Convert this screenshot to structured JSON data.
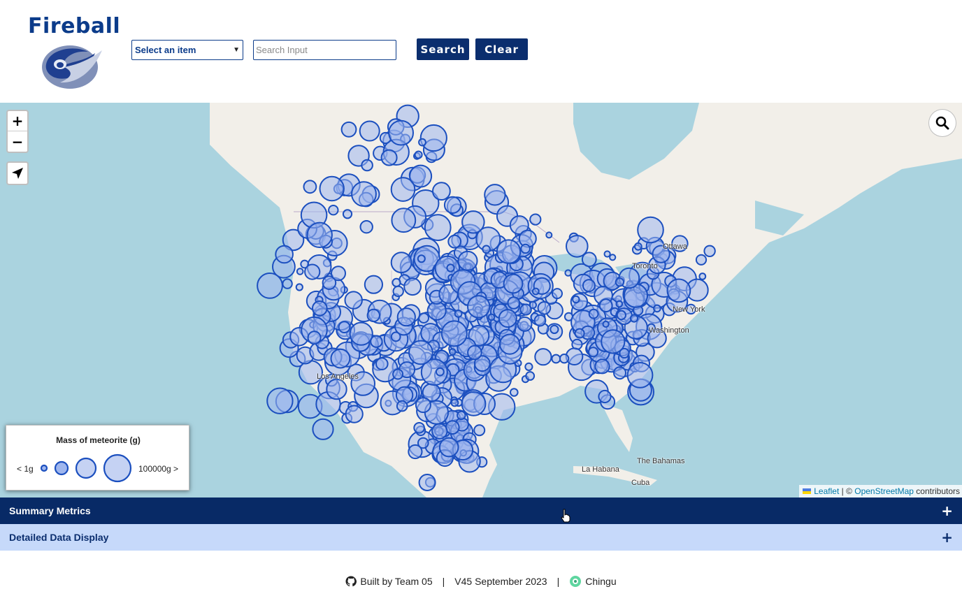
{
  "header": {
    "app_title": "Fireball",
    "select_value": "Select an item",
    "search_placeholder": "Search Input",
    "search_button": "Search",
    "clear_button": "Clear"
  },
  "map": {
    "zoom_in": "+",
    "zoom_out": "−",
    "places": [
      "Ottawa",
      "Toronto",
      "New York",
      "Washington",
      "Los Angeles",
      "La Habana",
      "The Bahamas",
      "Cuba"
    ],
    "legend": {
      "title": "Mass of meteorite (g)",
      "min_label": "< 1g",
      "max_label": "100000g >"
    },
    "attribution": {
      "leaflet": "Leaflet",
      "separator": " | © ",
      "osm": "OpenStreetMap",
      "contributors": " contributors"
    },
    "marker_color": "#1b4fbf",
    "marker_fill": "#9fb6ee"
  },
  "accordions": {
    "summary": "Summary Metrics",
    "detail": "Detailed Data Display",
    "expand_symbol": "+"
  },
  "footer": {
    "built_by": "Built by Team 05",
    "separator": "|",
    "version": "V45 September 2023",
    "chingu": "Chingu"
  }
}
